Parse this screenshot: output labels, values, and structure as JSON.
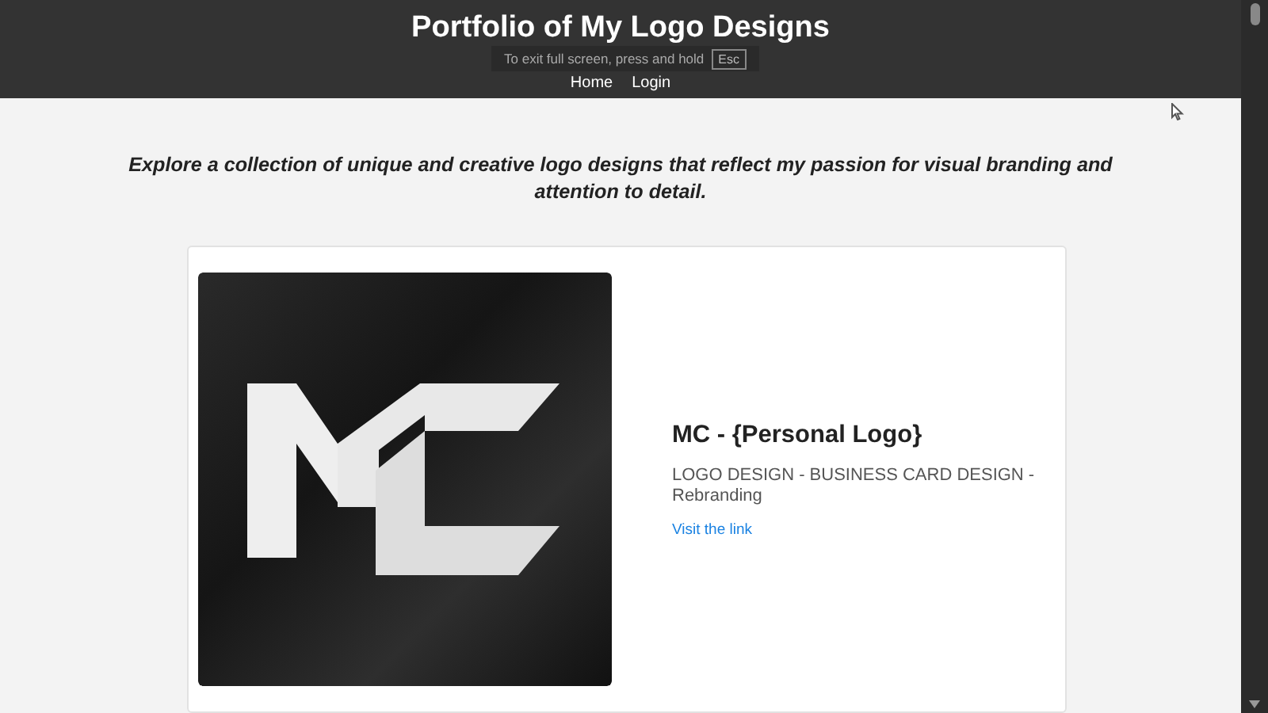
{
  "header": {
    "title": "Portfolio of My Logo Designs",
    "nav": [
      {
        "label": "Home"
      },
      {
        "label": "Login"
      }
    ]
  },
  "fullscreen_notice": {
    "text": "To exit full screen, press and hold",
    "key": "Esc"
  },
  "intro": "Explore a collection of unique and creative logo designs that reflect my passion for visual branding and attention to detail.",
  "projects": [
    {
      "title": "MC - {Personal Logo}",
      "services": "LOGO DESIGN - BUSINESS CARD DESIGN - Rebranding",
      "link": "Visit the link"
    }
  ]
}
